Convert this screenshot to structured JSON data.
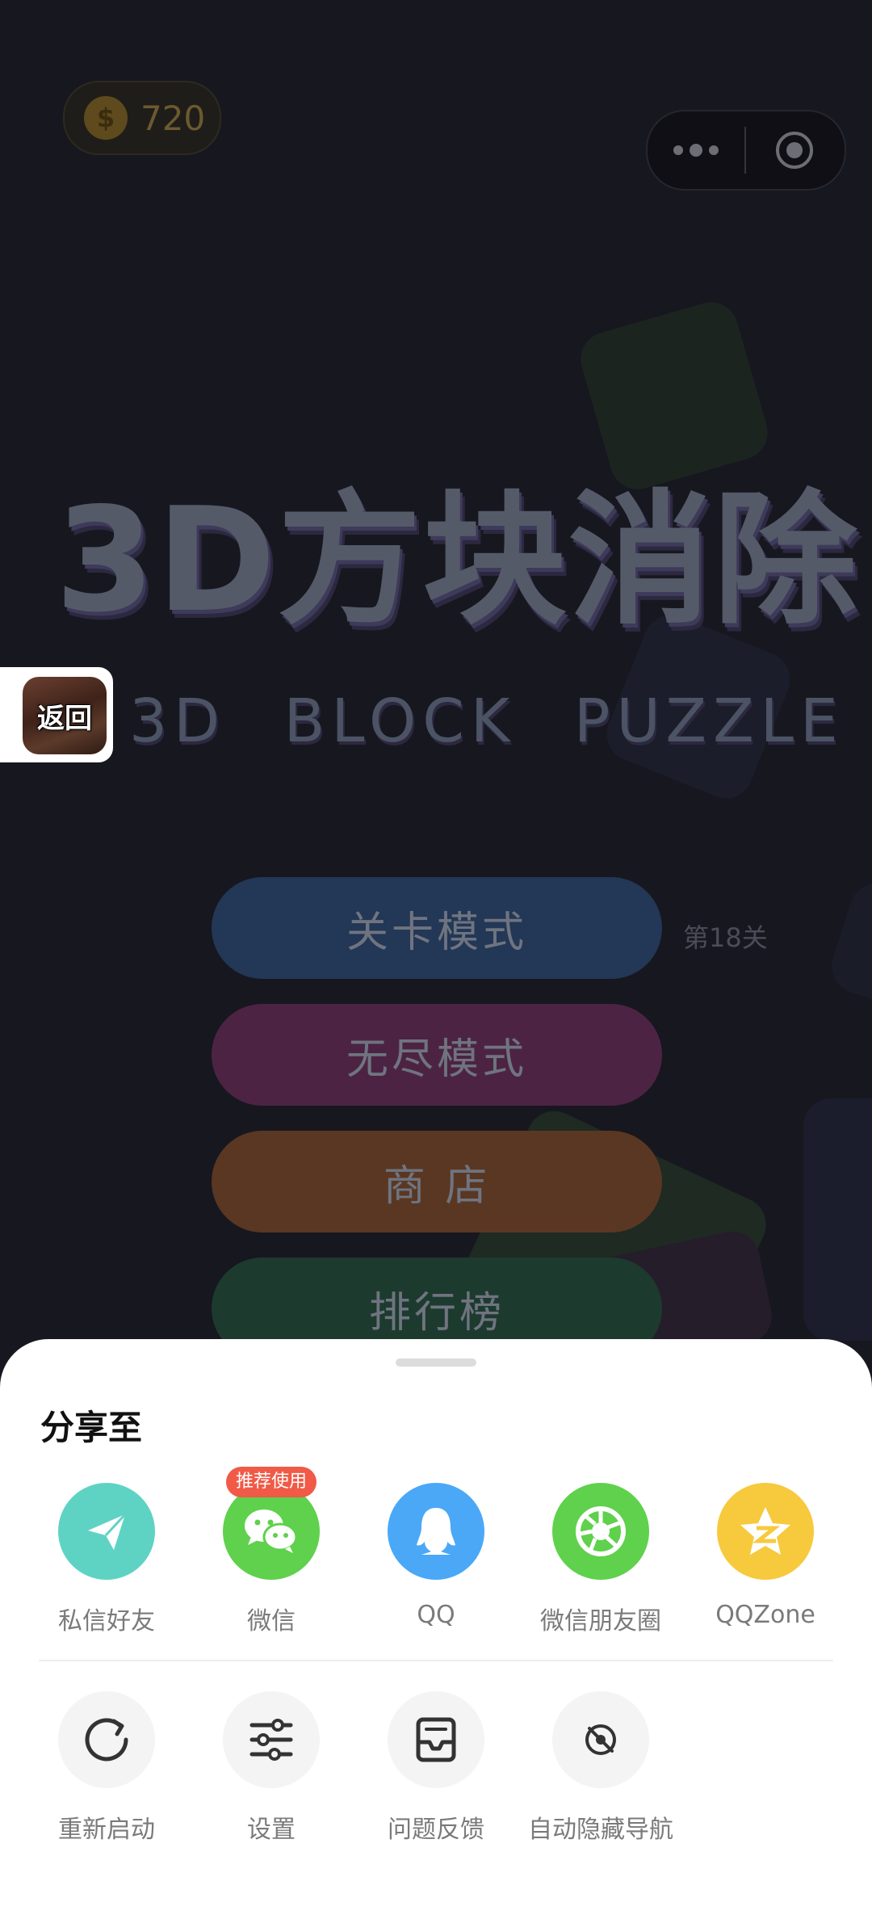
{
  "coins": {
    "symbol": "$",
    "count": "720"
  },
  "game": {
    "title_cn": "3D方块消除",
    "title_en": "3D BLOCK PUZZLE",
    "back_label": "返回",
    "menu": [
      {
        "label": "关卡模式",
        "color": "#233756"
      },
      {
        "label": "无尽模式",
        "color": "#4d2344"
      },
      {
        "label": "商 店",
        "color": "#5a3722"
      },
      {
        "label": "排行榜",
        "color": "#1d3a2e"
      }
    ],
    "level_label": "第18关"
  },
  "share_sheet": {
    "title": "分享至",
    "share_targets": [
      {
        "label": "私信好友",
        "icon": "paper-plane-icon",
        "color": "#5fd3c3"
      },
      {
        "label": "微信",
        "icon": "wechat-icon",
        "color": "#5fd14c",
        "badge": "推荐使用"
      },
      {
        "label": "QQ",
        "icon": "qq-penguin-icon",
        "color": "#4aa8f7"
      },
      {
        "label": "微信朋友圈",
        "icon": "moments-shutter-icon",
        "color": "#5fd14c"
      },
      {
        "label": "QQZone",
        "icon": "qzone-star-icon",
        "color": "#f7c93d"
      }
    ],
    "actions": [
      {
        "label": "重新启动",
        "icon": "restart-icon"
      },
      {
        "label": "设置",
        "icon": "settings-sliders-icon"
      },
      {
        "label": "问题反馈",
        "icon": "feedback-icon"
      },
      {
        "label": "自动隐藏导航",
        "icon": "hide-navigation-icon"
      }
    ]
  }
}
